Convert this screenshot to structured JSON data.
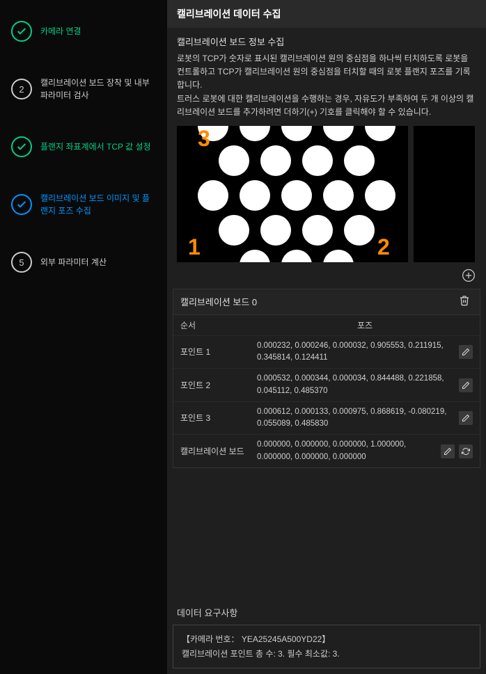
{
  "sidebar": {
    "steps": [
      {
        "label": "카메라 연결",
        "state": "done"
      },
      {
        "num": "2",
        "label": "캘리브레이션 보드 장착 및 내부 파라미터 검사",
        "state": "pending"
      },
      {
        "label": "플랜지 좌표계에서 TCP 값 설정",
        "state": "done"
      },
      {
        "label": "캘리브레이션 보드 이미지 및 플랜지 포즈 수집",
        "state": "active"
      },
      {
        "num": "5",
        "label": "외부 파라미터 계산",
        "state": "pending"
      }
    ]
  },
  "page": {
    "title": "캘리브레이션 데이터 수집",
    "section_title": "캘리브레이션 보드 정보 수집",
    "instructions_line1": "로봇의 TCP가 숫자로 표시된 캘리브레이션 원의 중심점을 하나씩 터치하도록 로봇을 컨트롤하고 TCP가 캘리브레이션 원의 중심점을 터치할 때의 로봇 플랜지 포즈를 기록합니다.",
    "instructions_line2": "트러스 로봇에 대한 캘리브레이션을 수행하는 경우, 자유도가 부족하여 두 개 이상의 캘리브레이션 보드를 추가하려면 더하기(+) 기호를 클릭해야 할 수 있습니다."
  },
  "board_markers": {
    "n1": "1",
    "n2": "2",
    "n3": "3"
  },
  "board_panel": {
    "title": "캘리브레이션 보드 0",
    "col_order": "순서",
    "col_pose": "포즈",
    "rows": [
      {
        "label": "포인트 1",
        "pose": "0.000232, 0.000246, 0.000032, 0.905553, 0.211915, 0.345814, 0.124411"
      },
      {
        "label": "포인트 2",
        "pose": "0.000532, 0.000344, 0.000034, 0.844488, 0.221858, 0.045112, 0.485370"
      },
      {
        "label": "포인트 3",
        "pose": "0.000612, 0.000133, 0.000975, 0.868619, -0.080219, 0.055089, 0.485830"
      },
      {
        "label": "캘리브레이션 보드",
        "pose": "0.000000, 0.000000, 0.000000, 1.000000, 0.000000, 0.000000, 0.000000"
      }
    ]
  },
  "requirements": {
    "title": "데이터 요구사항",
    "line1": "【카메라 번호：  YEA25245A500YD22】",
    "line2": "캘리브레이션 포인트 총 수: 3. 필수 최소값: 3."
  }
}
